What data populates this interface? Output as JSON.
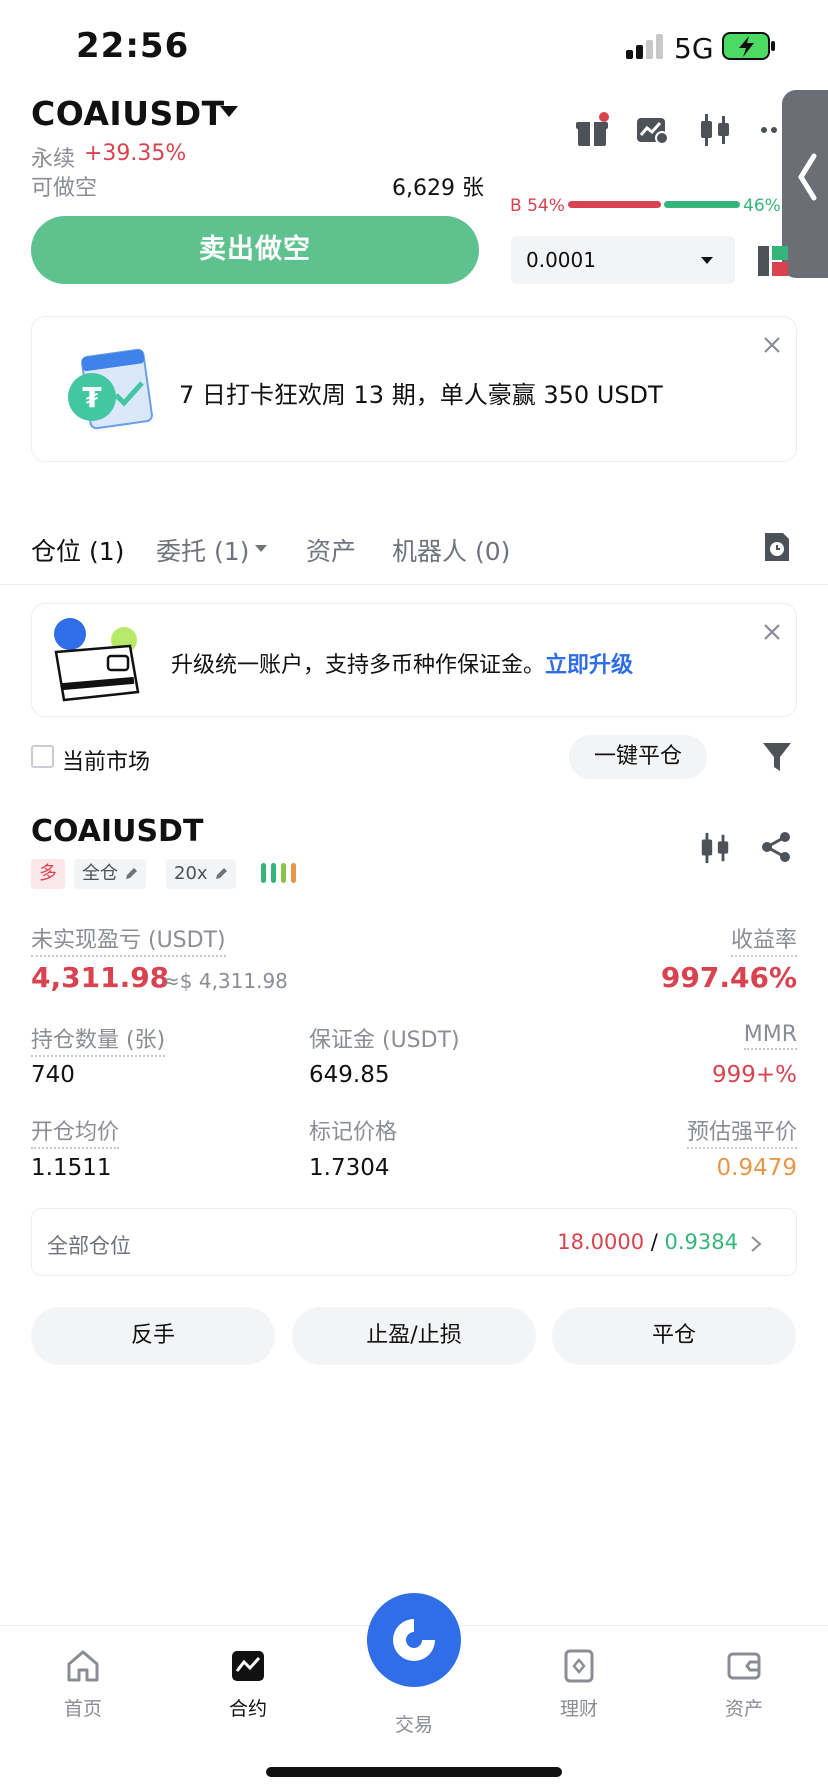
{
  "status_bar": {
    "time": "22:56",
    "network": "5G"
  },
  "header": {
    "pair": "COAIUSDT",
    "perp_label": "永续",
    "change": "+39.35%",
    "available_short_label": "可做空",
    "available_short_value": "6,629 张",
    "sell_button": "卖出做空",
    "bs_buy": "B 54%",
    "bs_sell": "46%",
    "buy_ratio": 0.54,
    "precision": "0.0001"
  },
  "promo": {
    "text": "7 日打卡狂欢周 13 期，单人豪赢 350 USDT"
  },
  "tabs": [
    {
      "label": "仓位 (1)"
    },
    {
      "label": "委托 (1)"
    },
    {
      "label": "资产"
    },
    {
      "label": "机器人 (0)"
    }
  ],
  "upgrade": {
    "text": "升级统一账户，支持多币种作保证金。",
    "link": "立即升级"
  },
  "filter": {
    "current_market": "当前市场",
    "close_all": "一键平仓"
  },
  "position": {
    "symbol": "COAIUSDT",
    "side_tag": "多",
    "margin_mode": "全仓",
    "leverage": "20x",
    "unrealized_pnl_label": "未实现盈亏 (USDT)",
    "unrealized_pnl": "4,311.98",
    "unrealized_pnl_usd": "≈$ 4,311.98",
    "roe_label": "收益率",
    "roe": "997.46%",
    "size_label": "持仓数量 (张)",
    "size": "740",
    "margin_label": "保证金 (USDT)",
    "margin": "649.85",
    "mmr_label": "MMR",
    "mmr": "999+%",
    "entry_label": "开仓均价",
    "entry": "1.1511",
    "mark_label": "标记价格",
    "mark": "1.7304",
    "liq_label": "预估强平价",
    "liq": "0.9479",
    "all_positions_label": "全部仓位",
    "all_positions_red": "18.0000",
    "all_positions_sep": "/",
    "all_positions_green": "0.9384",
    "btn_reverse": "反手",
    "btn_tpsl": "止盈/止损",
    "btn_close": "平仓"
  },
  "nav": {
    "home": "首页",
    "futures": "合约",
    "trade": "交易",
    "earn": "理财",
    "assets": "资产"
  },
  "colors": {
    "red": "#d9434f",
    "green": "#35b57a",
    "orange": "#e8964a",
    "blue": "#2f6ee6",
    "sell_button": "#5ec28f"
  }
}
